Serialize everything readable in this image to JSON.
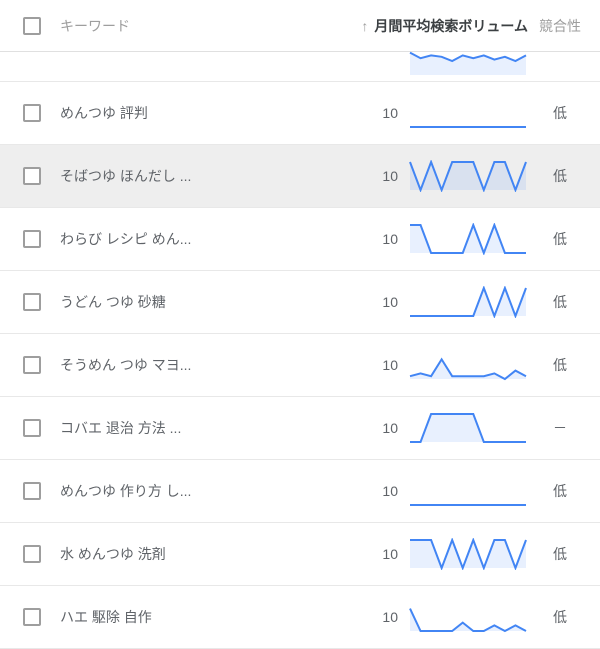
{
  "headers": {
    "keyword": "キーワード",
    "volume": "月間平均検索ボリューム",
    "competition": "競合性",
    "sort_indicator": "↑"
  },
  "partial_row": {
    "spark": [
      0.2,
      0.4,
      0.3,
      0.35,
      0.5,
      0.3,
      0.4,
      0.3,
      0.45,
      0.35,
      0.5,
      0.3
    ]
  },
  "rows": [
    {
      "keyword": "めんつゆ 評判",
      "volume": "10",
      "competition": "低",
      "hover": false,
      "spark": [
        1,
        1,
        1,
        1,
        1,
        1,
        1,
        1,
        1,
        1,
        1,
        1
      ]
    },
    {
      "keyword": "そばつゆ ほんだし ...",
      "volume": "10",
      "competition": "低",
      "hover": true,
      "spark": [
        0,
        1,
        0,
        1,
        0,
        0,
        0,
        1,
        0,
        0,
        1,
        0
      ]
    },
    {
      "keyword": "わらび レシピ めん...",
      "volume": "10",
      "competition": "低",
      "hover": false,
      "spark": [
        0,
        0,
        1,
        1,
        1,
        1,
        0,
        1,
        0,
        1,
        1,
        1
      ]
    },
    {
      "keyword": "うどん つゆ 砂糖",
      "volume": "10",
      "competition": "低",
      "hover": false,
      "spark": [
        1,
        1,
        1,
        1,
        1,
        1,
        1,
        0,
        1,
        0,
        1,
        0
      ]
    },
    {
      "keyword": "そうめん つゆ マヨ...",
      "volume": "10",
      "competition": "低",
      "hover": false,
      "spark": [
        0.9,
        0.8,
        0.9,
        0.3,
        0.9,
        0.9,
        0.9,
        0.9,
        0.8,
        1,
        0.7,
        0.9
      ]
    },
    {
      "keyword": "コバエ 退治 方法 ...",
      "volume": "10",
      "competition": "－",
      "hover": false,
      "spark": [
        1,
        1,
        0,
        0,
        0,
        0,
        0,
        1,
        1,
        1,
        1,
        1
      ]
    },
    {
      "keyword": "めんつゆ 作り方 し...",
      "volume": "10",
      "competition": "低",
      "hover": false,
      "spark": [
        1,
        1,
        1,
        1,
        1,
        1,
        1,
        1,
        1,
        1,
        1,
        1
      ]
    },
    {
      "keyword": "水 めんつゆ 洗剤",
      "volume": "10",
      "competition": "低",
      "hover": false,
      "spark": [
        0,
        0,
        0,
        1,
        0,
        1,
        0,
        1,
        0,
        0,
        1,
        0
      ]
    },
    {
      "keyword": "ハエ 駆除 自作",
      "volume": "10",
      "competition": "低",
      "hover": false,
      "spark": [
        0.2,
        1,
        1,
        1,
        1,
        0.7,
        1,
        1,
        0.8,
        1,
        0.8,
        1
      ]
    }
  ],
  "chart_data": {
    "type": "line",
    "note": "Sparkline trends per keyword row; 12 monthly points each, normalized 0=high 1=baseline (visual estimate only).",
    "series": [
      {
        "name": "めんつゆ 評判",
        "values": [
          1,
          1,
          1,
          1,
          1,
          1,
          1,
          1,
          1,
          1,
          1,
          1
        ]
      },
      {
        "name": "そばつゆ ほんだし",
        "values": [
          0,
          1,
          0,
          1,
          0,
          0,
          0,
          1,
          0,
          0,
          1,
          0
        ]
      },
      {
        "name": "わらび レシピ めん",
        "values": [
          0,
          0,
          1,
          1,
          1,
          1,
          0,
          1,
          0,
          1,
          1,
          1
        ]
      },
      {
        "name": "うどん つゆ 砂糖",
        "values": [
          1,
          1,
          1,
          1,
          1,
          1,
          1,
          0,
          1,
          0,
          1,
          0
        ]
      },
      {
        "name": "そうめん つゆ マヨ",
        "values": [
          0.9,
          0.8,
          0.9,
          0.3,
          0.9,
          0.9,
          0.9,
          0.9,
          0.8,
          1,
          0.7,
          0.9
        ]
      },
      {
        "name": "コバエ 退治 方法",
        "values": [
          1,
          1,
          0,
          0,
          0,
          0,
          0,
          1,
          1,
          1,
          1,
          1
        ]
      },
      {
        "name": "めんつゆ 作り方 し",
        "values": [
          1,
          1,
          1,
          1,
          1,
          1,
          1,
          1,
          1,
          1,
          1,
          1
        ]
      },
      {
        "name": "水 めんつゆ 洗剤",
        "values": [
          0,
          0,
          0,
          1,
          0,
          1,
          0,
          1,
          0,
          0,
          1,
          0
        ]
      },
      {
        "name": "ハエ 駆除 自作",
        "values": [
          0.2,
          1,
          1,
          1,
          1,
          0.7,
          1,
          1,
          0.8,
          1,
          0.8,
          1
        ]
      }
    ]
  }
}
